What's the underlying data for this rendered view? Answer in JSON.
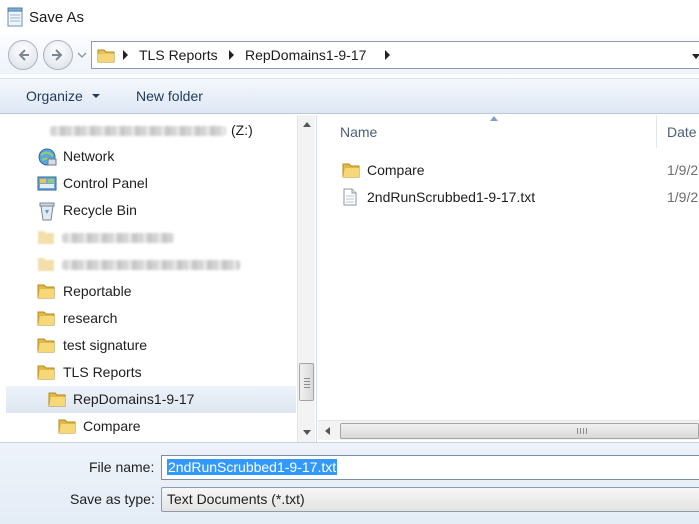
{
  "window": {
    "title": "Save As"
  },
  "address": {
    "breadcrumbs": [
      "TLS Reports",
      "RepDomains1-9-17"
    ]
  },
  "toolbar": {
    "organize_label": "Organize",
    "new_folder_label": "New folder"
  },
  "nav_tree": [
    {
      "label": "(Z:)",
      "icon": "network-drive-icon",
      "blurred_prefix": true
    },
    {
      "label": "Network",
      "icon": "network-icon"
    },
    {
      "label": "Control Panel",
      "icon": "control-panel-icon"
    },
    {
      "label": "Recycle Bin",
      "icon": "recycle-bin-icon"
    },
    {
      "label": "",
      "icon": "folder-icon",
      "blurred": true
    },
    {
      "label": "",
      "icon": "folder-icon",
      "blurred": true
    },
    {
      "label": "Reportable",
      "icon": "folder-icon"
    },
    {
      "label": "research",
      "icon": "folder-icon"
    },
    {
      "label": "test signature",
      "icon": "folder-icon"
    },
    {
      "label": "TLS Reports",
      "icon": "folder-icon"
    },
    {
      "label": "RepDomains1-9-17",
      "icon": "folder-icon",
      "selected": true
    },
    {
      "label": "Compare",
      "icon": "folder-icon"
    }
  ],
  "file_list": {
    "columns": [
      "Name",
      "Date"
    ],
    "items": [
      {
        "name": "Compare",
        "date": "1/9/2",
        "icon": "folder-icon"
      },
      {
        "name": "2ndRunScrubbed1-9-17.txt",
        "date": "1/9/2",
        "icon": "text-file-icon"
      }
    ]
  },
  "form": {
    "file_name_label": "File name:",
    "file_name_value": "2ndRunScrubbed1-9-17.txt",
    "save_as_type_label": "Save as type:",
    "save_as_type_value": "Text Documents (*.txt)"
  },
  "colors": {
    "accent": "#3399ff",
    "command_text": "#1e395b",
    "header_text": "#4c607a"
  }
}
